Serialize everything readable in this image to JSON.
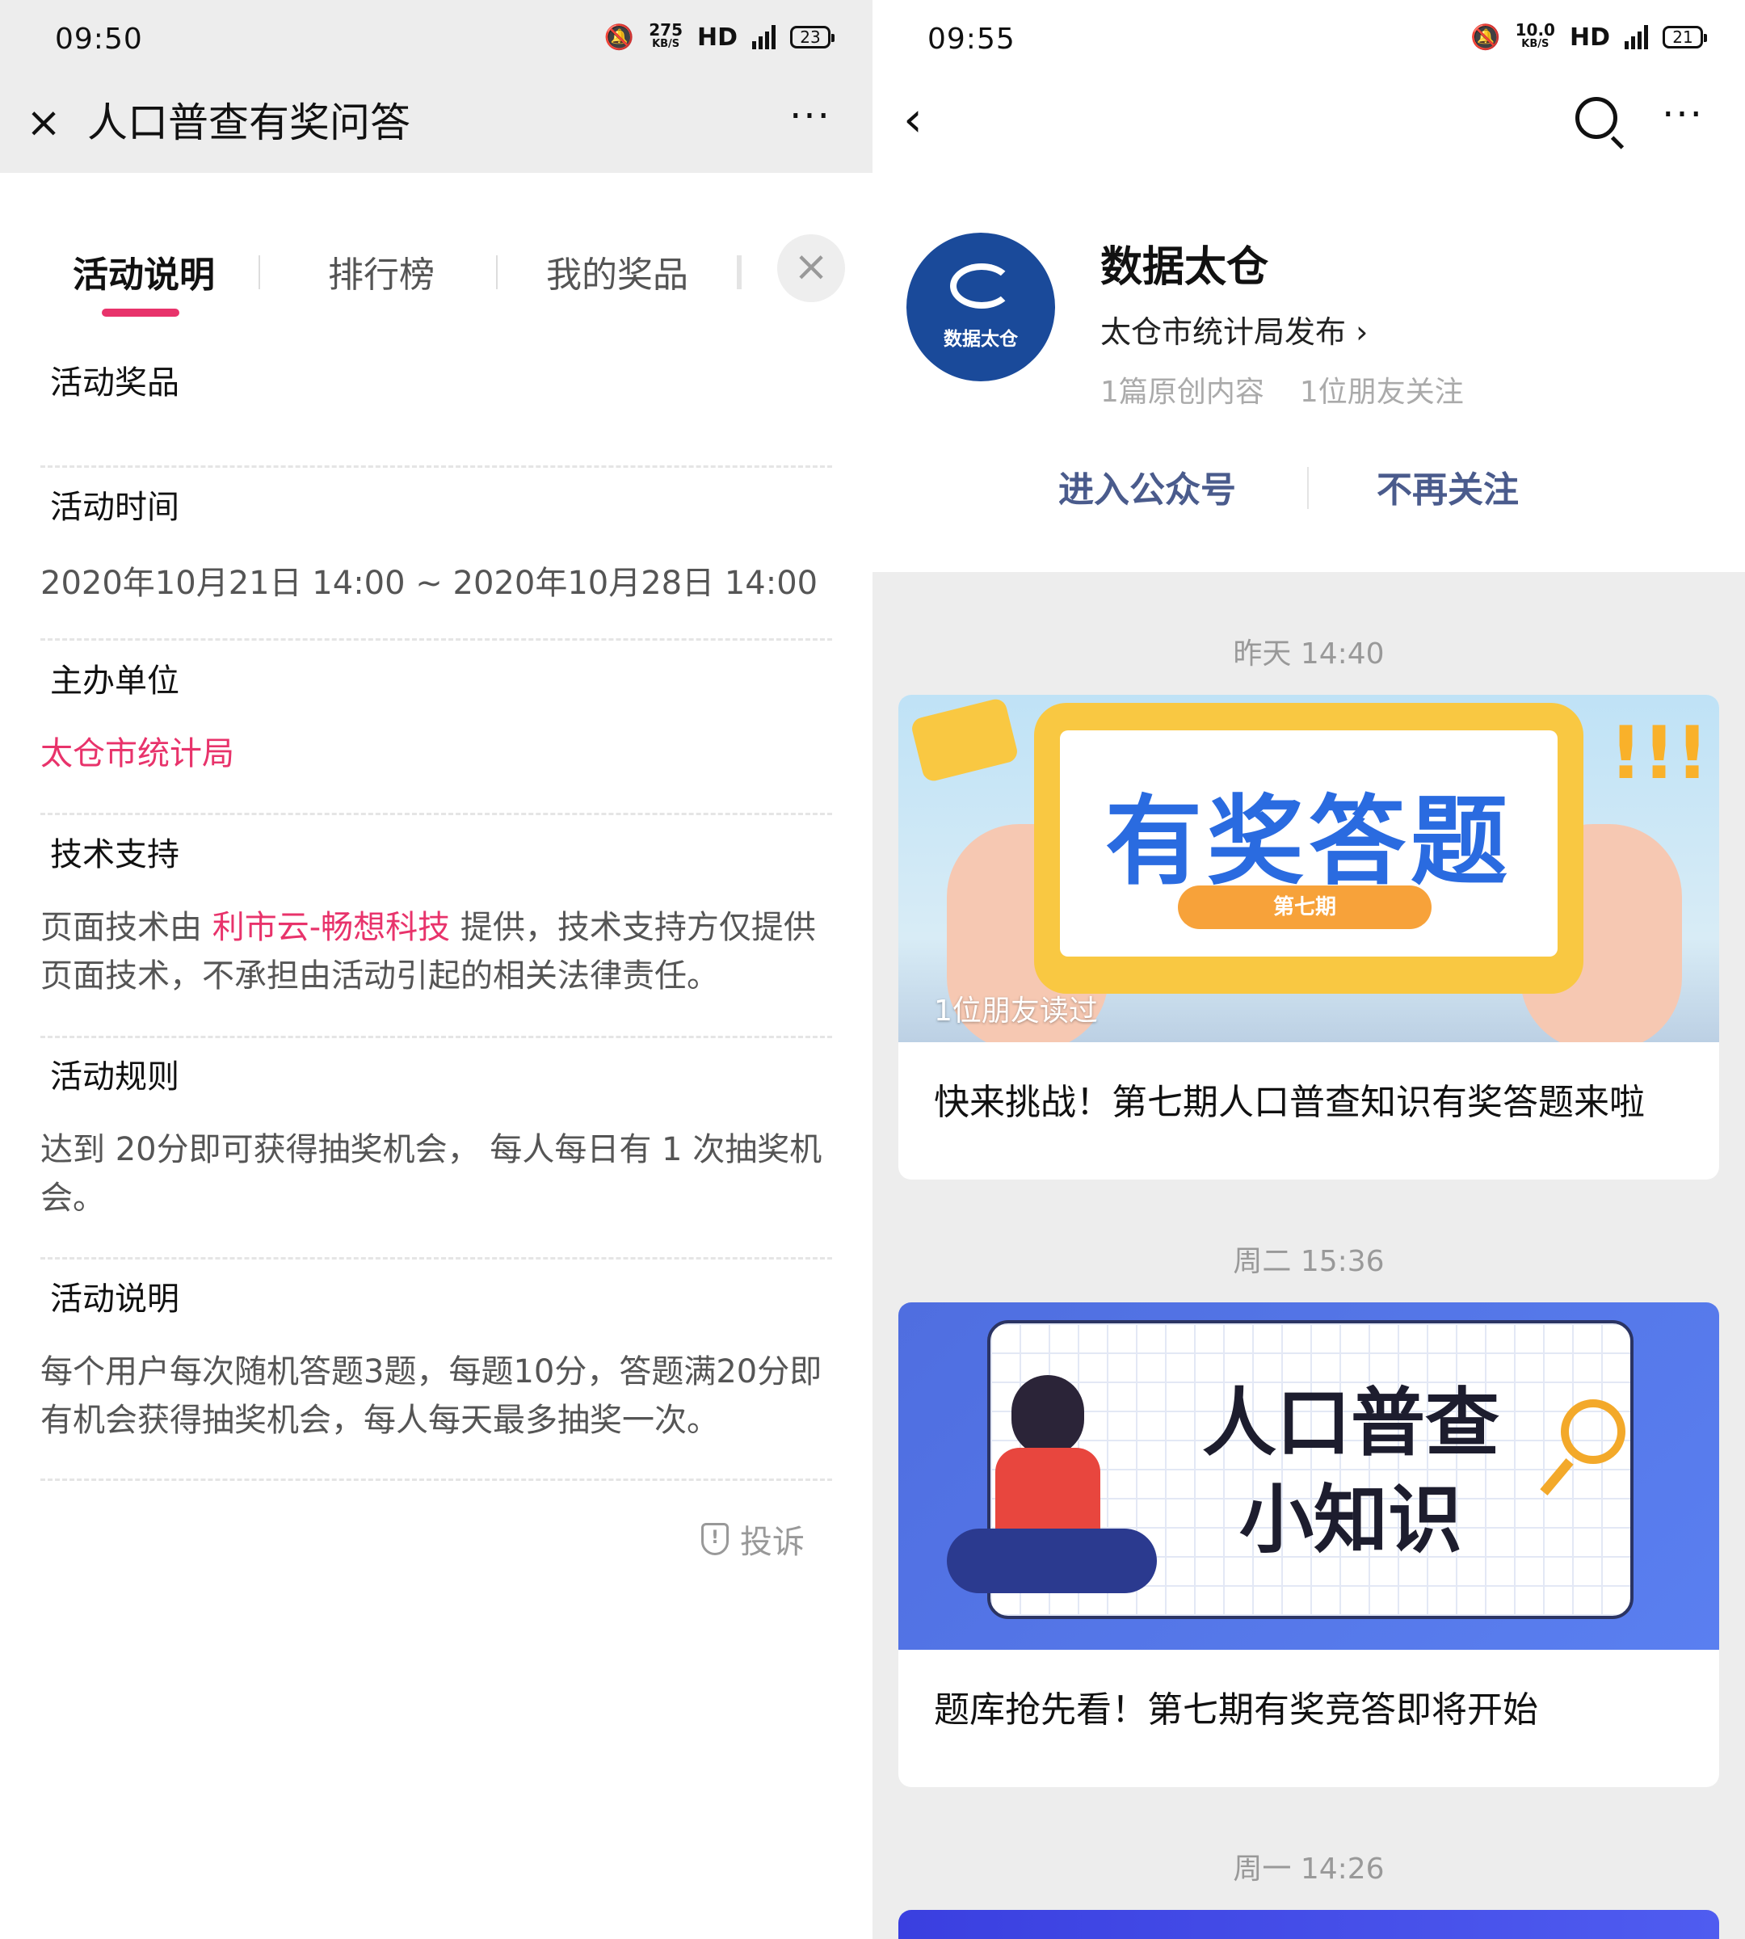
{
  "left": {
    "status": {
      "time": "09:50",
      "speed": "275",
      "speed_unit": "KB/S",
      "hd": "HD",
      "net": "4G",
      "battery": "23"
    },
    "nav": {
      "title": "人口普查有奖问答",
      "close_icon": "close-icon",
      "more_label": "···"
    },
    "tabs": [
      "活动说明",
      "排行榜",
      "我的奖品"
    ],
    "tab_close": "×",
    "sections": {
      "prize": {
        "label": "活动奖品"
      },
      "time": {
        "label": "活动时间",
        "text": "2020年10月21日 14:00 ~ 2020年10月28日 14:00"
      },
      "host": {
        "label": "主办单位",
        "text": "太仓市统计局"
      },
      "tech": {
        "label": "技术支持",
        "prefix": "页面技术由 ",
        "link": "利市云-畅想科技",
        "suffix": " 提供，技术支持方仅提供页面技术，不承担由活动引起的相关法律责任。"
      },
      "rules": {
        "label": "活动规则",
        "text": "达到 20分即可获得抽奖机会， 每人每日有 1 次抽奖机会。"
      },
      "desc": {
        "label": "活动说明",
        "text": "每个用户每次随机答题3题，每题10分，答题满20分即有机会获得抽奖机会，每人每天最多抽奖一次。"
      }
    },
    "complain": "投诉",
    "colors": {
      "accent": "#e8336b",
      "header_bg": "#ededed"
    }
  },
  "right": {
    "status": {
      "time": "09:55",
      "speed": "10.0",
      "speed_unit": "KB/S",
      "hd": "HD",
      "net": "4G",
      "battery": "21"
    },
    "account": {
      "name": "数据太仓",
      "logo_text": "数据太仓",
      "publisher": "太仓市统计局发布 ›",
      "stats": [
        "1篇原创内容",
        "1位朋友关注"
      ],
      "enter": "进入公众号",
      "unfollow": "不再关注"
    },
    "posts": [
      {
        "time": "昨天 14:40",
        "cover_title": "有奖答题",
        "cover_badge": "第七期",
        "read_by": "1位朋友读过",
        "title": "快来挑战！第七期人口普查知识有奖答题来啦"
      },
      {
        "time": "周二 15:36",
        "cover_title_line1": "人口普查",
        "cover_title_line2": "小知识",
        "title": "题库抢先看！第七期有奖竞答即将开始"
      },
      {
        "time": "周一 14:26"
      }
    ],
    "colors": {
      "link": "#4a5b8c",
      "logo": "#1a4a9a",
      "bg": "#ededed"
    }
  }
}
